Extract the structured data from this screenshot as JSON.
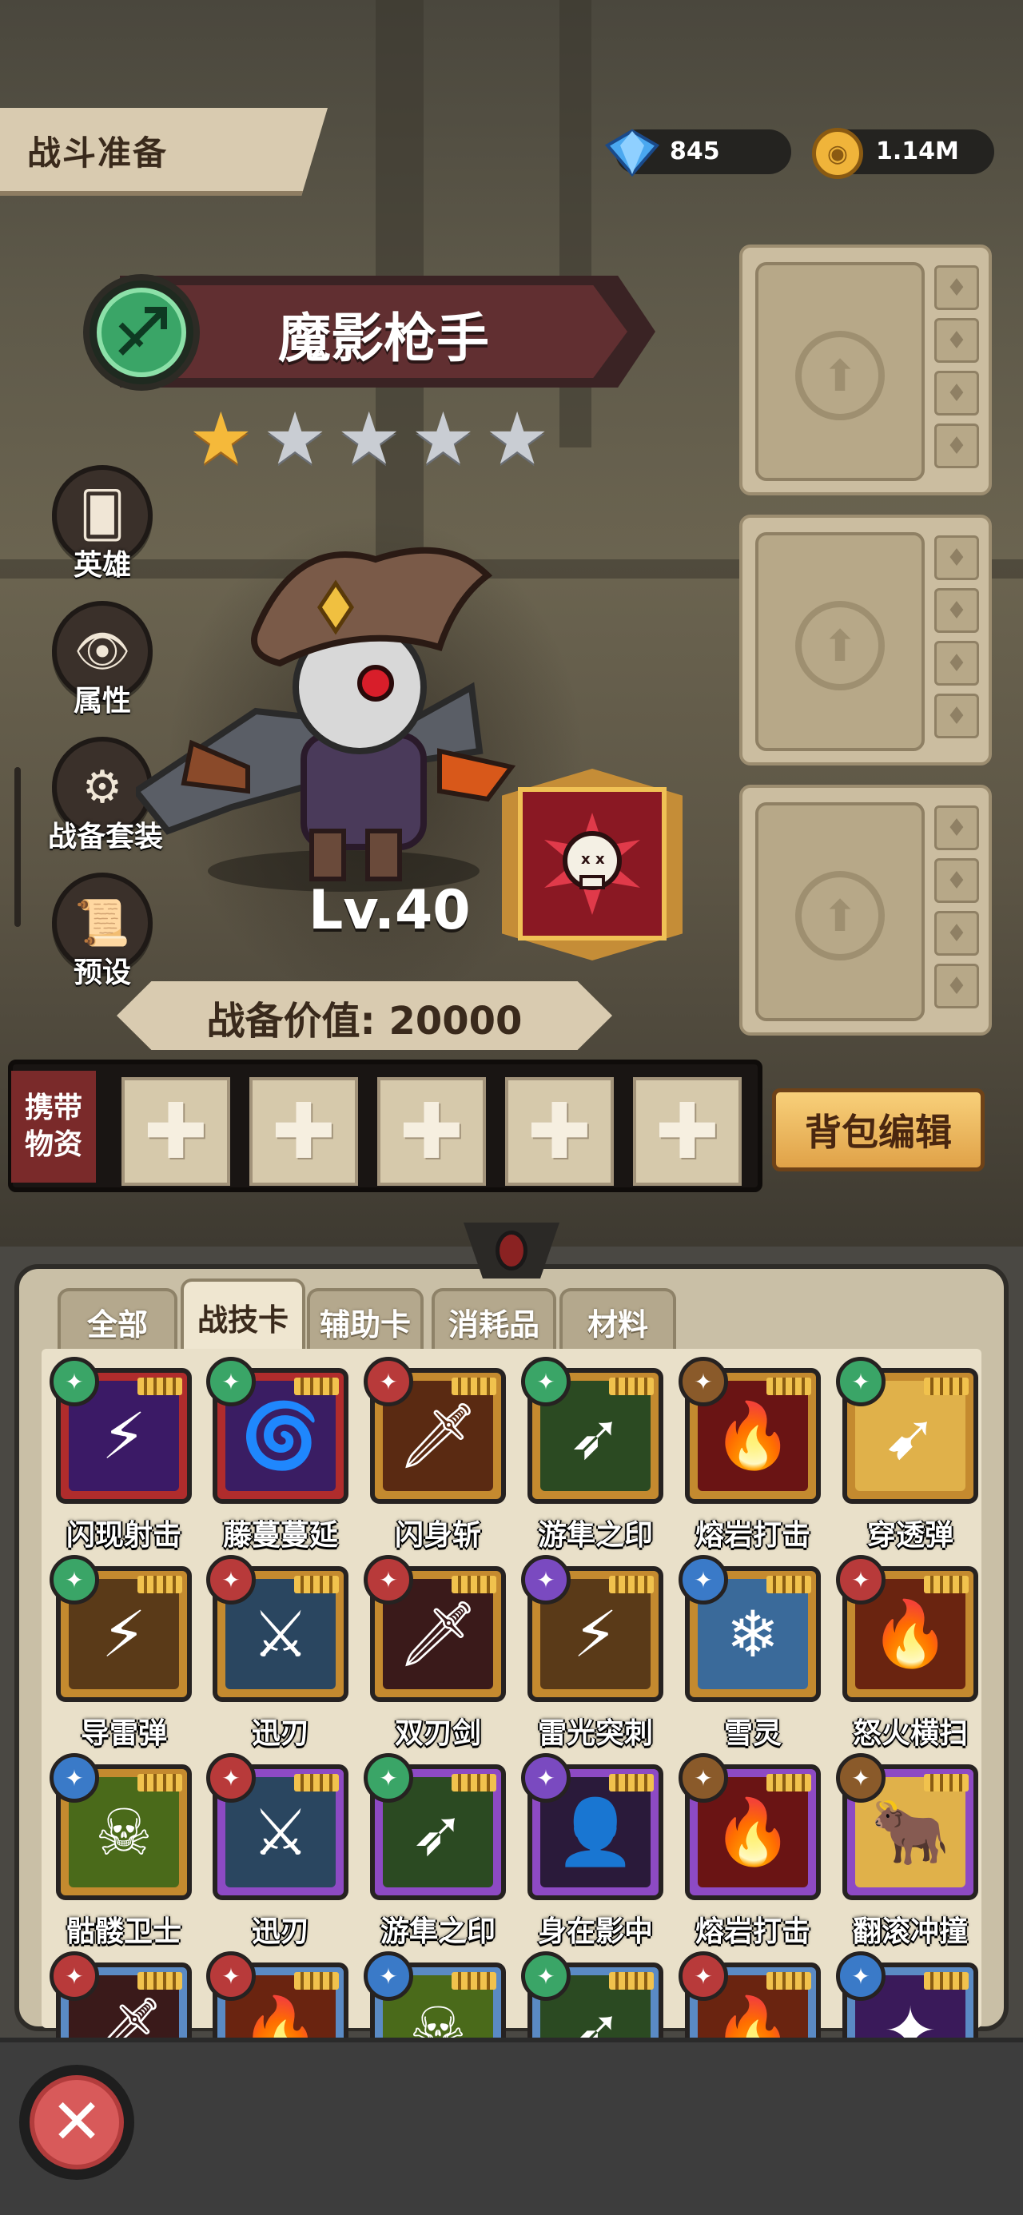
{
  "header": {
    "title": "战斗准备",
    "gems": "845",
    "gold": "1.14M"
  },
  "hero": {
    "name": "魔影枪手",
    "stars_total": 5,
    "stars_filled": 1,
    "level": "Lv.40",
    "power": "战备价值: 20000"
  },
  "side_menu": [
    {
      "label": "英雄",
      "icon": "hero-cards-icon"
    },
    {
      "label": "属性",
      "icon": "eye-icon"
    },
    {
      "label": "战备套装",
      "icon": "gear-set-icon"
    },
    {
      "label": "预设",
      "icon": "scroll-icon"
    }
  ],
  "carry": {
    "label_line1": "携带",
    "label_line2": "物资",
    "slot_count": 5,
    "bag_button": "背包编辑"
  },
  "tabs": [
    {
      "label": "全部",
      "active": false
    },
    {
      "label": "战技卡",
      "active": true
    },
    {
      "label": "辅助卡",
      "active": false
    },
    {
      "label": "消耗品",
      "active": false
    },
    {
      "label": "材料",
      "active": false
    }
  ],
  "cards": [
    {
      "name": "闪现射击",
      "frame": "#b02c2c",
      "bg": "#3b1a66",
      "cls": "green",
      "glyph": "⚡"
    },
    {
      "name": "藤蔓蔓延",
      "frame": "#b02c2c",
      "bg": "#3a1d63",
      "cls": "green",
      "glyph": "🌀"
    },
    {
      "name": "闪身斩",
      "frame": "#c48a2f",
      "bg": "#5a2a12",
      "cls": "red",
      "glyph": "🗡"
    },
    {
      "name": "游隼之印",
      "frame": "#c48a2f",
      "bg": "#2b4a22",
      "cls": "green",
      "glyph": "➶"
    },
    {
      "name": "熔岩打击",
      "frame": "#c48a2f",
      "bg": "#6a1414",
      "cls": "brown",
      "glyph": "🔥"
    },
    {
      "name": "穿透弹",
      "frame": "#c48a2f",
      "bg": "#e0b14a",
      "cls": "green",
      "glyph": "➹"
    },
    {
      "name": "导雷弹",
      "frame": "#c48a2f",
      "bg": "#5a3a18",
      "cls": "green",
      "glyph": "⚡"
    },
    {
      "name": "迅刃",
      "frame": "#c48a2f",
      "bg": "#2a4660",
      "cls": "red",
      "glyph": "⚔"
    },
    {
      "name": "双刃剑",
      "frame": "#c48a2f",
      "bg": "#3a1a1a",
      "cls": "red",
      "glyph": "🗡"
    },
    {
      "name": "雷光突刺",
      "frame": "#c48a2f",
      "bg": "#5a3a18",
      "cls": "purple",
      "glyph": "⚡"
    },
    {
      "name": "雪灵",
      "frame": "#c48a2f",
      "bg": "#3a6a9a",
      "cls": "blue",
      "glyph": "❄"
    },
    {
      "name": "怒火横扫",
      "frame": "#c48a2f",
      "bg": "#6a2410",
      "cls": "red",
      "glyph": "🔥"
    },
    {
      "name": "骷髅卫士",
      "frame": "#c48a2f",
      "bg": "#4a6a1a",
      "cls": "blue",
      "glyph": "☠"
    },
    {
      "name": "迅刃",
      "frame": "#8d4ac4",
      "bg": "#2a4660",
      "cls": "red",
      "glyph": "⚔"
    },
    {
      "name": "游隼之印",
      "frame": "#8d4ac4",
      "bg": "#2b4a22",
      "cls": "green",
      "glyph": "➶"
    },
    {
      "name": "身在影中",
      "frame": "#8d4ac4",
      "bg": "#2a1a3a",
      "cls": "purple",
      "glyph": "👤"
    },
    {
      "name": "熔岩打击",
      "frame": "#8d4ac4",
      "bg": "#6a1414",
      "cls": "brown",
      "glyph": "🔥"
    },
    {
      "name": "翻滚冲撞",
      "frame": "#8d4ac4",
      "bg": "#e0b14a",
      "cls": "brown",
      "glyph": "🐂"
    },
    {
      "name": "",
      "frame": "#5a8ac4",
      "bg": "#3a1a1a",
      "cls": "red",
      "glyph": "🗡"
    },
    {
      "name": "",
      "frame": "#5a8ac4",
      "bg": "#6a2410",
      "cls": "red",
      "glyph": "🔥"
    },
    {
      "name": "",
      "frame": "#5a8ac4",
      "bg": "#4a6a1a",
      "cls": "blue",
      "glyph": "☠"
    },
    {
      "name": "",
      "frame": "#5a8ac4",
      "bg": "#2b4a22",
      "cls": "green",
      "glyph": "➶"
    },
    {
      "name": "",
      "frame": "#5a8ac4",
      "bg": "#6a2410",
      "cls": "red",
      "glyph": "🔥"
    },
    {
      "name": "",
      "frame": "#5a8ac4",
      "bg": "#3a1a5a",
      "cls": "blue",
      "glyph": "✦"
    }
  ],
  "class_colors": {
    "green": "#3aa567",
    "red": "#b83a3a",
    "brown": "#8a5a2a",
    "purple": "#7a4ac0",
    "blue": "#3a7ac8"
  },
  "close_label": "✕"
}
